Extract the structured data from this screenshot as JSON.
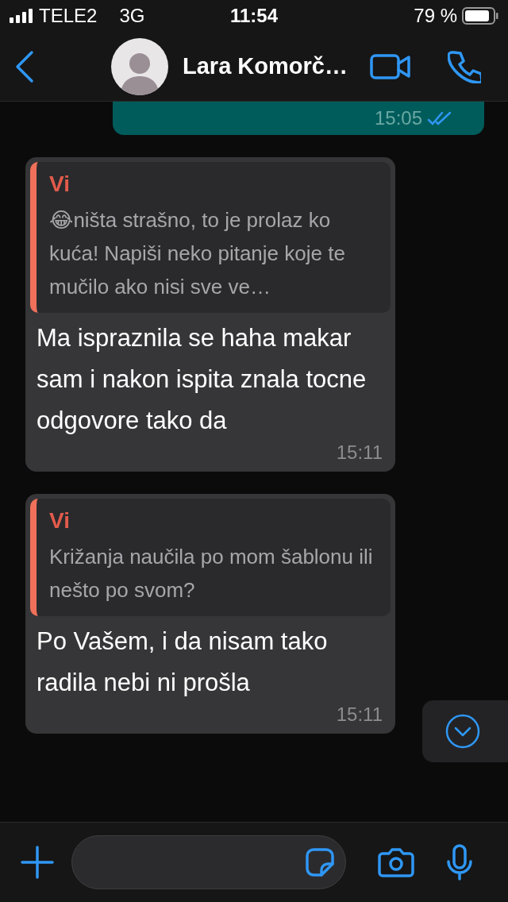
{
  "status_bar": {
    "carrier": "TELE2",
    "network": "3G",
    "time": "11:54",
    "battery": "79 %"
  },
  "header": {
    "contact_name": "Lara Komorč…"
  },
  "messages": [
    {
      "kind": "sent",
      "time": "15:05",
      "read": true
    },
    {
      "kind": "received",
      "quote": {
        "author": "Vi",
        "text": "😂ništa strašno, to je prolaz ko kuća! Napiši neko pitanje koje te mučilo ako nisi sve ve…"
      },
      "text": "Ma ispraznila se haha makar sam i nakon ispita znala tocne odgovore tako da",
      "time": "15:11"
    },
    {
      "kind": "received",
      "quote": {
        "author": "Vi",
        "text": "Križanja naučila po mom šablonu ili nešto po svom?"
      },
      "text": "Po Vašem, i da nisam tako radila nebi ni prošla",
      "time": "15:11"
    }
  ]
}
